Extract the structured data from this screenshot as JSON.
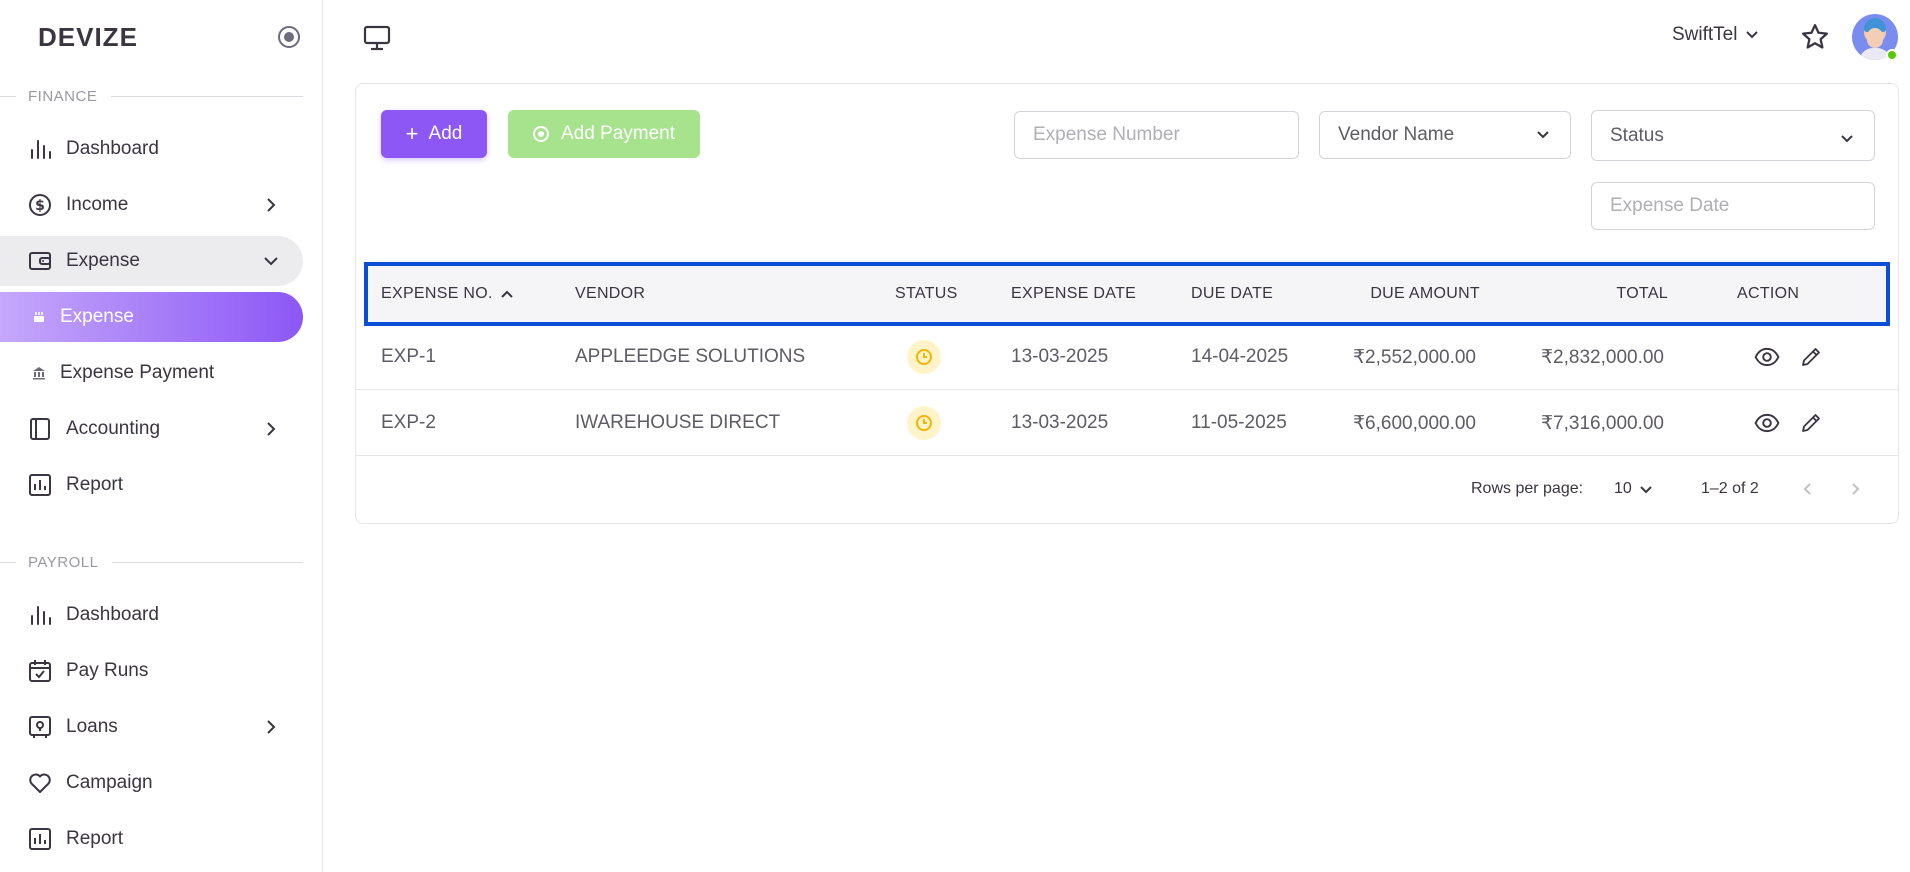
{
  "brand": "DEVIZE",
  "sidebar": {
    "finance_label": "FINANCE",
    "payroll_label": "PAYROLL",
    "finance_items": [
      {
        "label": "Dashboard",
        "icon": "bar-chart-icon"
      },
      {
        "label": "Income",
        "icon": "dollar-circle-icon"
      },
      {
        "label": "Expense",
        "icon": "wallet-icon"
      },
      {
        "label": "Expense",
        "icon": "sub-item-icon"
      },
      {
        "label": "Expense Payment",
        "icon": "bank-icon"
      },
      {
        "label": "Accounting",
        "icon": "book-icon"
      },
      {
        "label": "Report",
        "icon": "report-icon"
      }
    ],
    "payroll_items": [
      {
        "label": "Dashboard",
        "icon": "bar-chart-icon"
      },
      {
        "label": "Pay Runs",
        "icon": "calendar-check-icon"
      },
      {
        "label": "Loans",
        "icon": "safe-icon"
      },
      {
        "label": "Campaign",
        "icon": "heart-icon"
      },
      {
        "label": "Report",
        "icon": "report-icon"
      }
    ]
  },
  "topbar": {
    "company": "SwiftTel"
  },
  "toolbar": {
    "add_label": "Add",
    "add_payment_label": "Add Payment",
    "expense_number_placeholder": "Expense Number",
    "vendor_name_label": "Vendor Name",
    "status_label": "Status",
    "expense_date_placeholder": "Expense Date"
  },
  "table": {
    "headers": {
      "expense_no": "EXPENSE NO.",
      "vendor": "VENDOR",
      "status": "STATUS",
      "expense_date": "EXPENSE DATE",
      "due_date": "DUE DATE",
      "due_amount": "DUE AMOUNT",
      "total": "TOTAL",
      "action": "ACTION"
    },
    "rows": [
      {
        "expense_no": "EXP-1",
        "vendor": "APPLEEDGE SOLUTIONS",
        "expense_date": "13-03-2025",
        "due_date": "14-04-2025",
        "due_amount": "₹2,552,000.00",
        "total": "₹2,832,000.00"
      },
      {
        "expense_no": "EXP-2",
        "vendor": "IWAREHOUSE DIRECT",
        "expense_date": "13-03-2025",
        "due_date": "11-05-2025",
        "due_amount": "₹6,600,000.00",
        "total": "₹7,316,000.00"
      }
    ]
  },
  "pagination": {
    "rows_per_page_label": "Rows per page:",
    "rows_per_page_value": "10",
    "range": "1–2 of 2"
  },
  "colors": {
    "primary": "#8c57f5",
    "success_light": "#a6e38c",
    "highlight_border": "#0a4fd6",
    "pending": "#f5b400"
  }
}
